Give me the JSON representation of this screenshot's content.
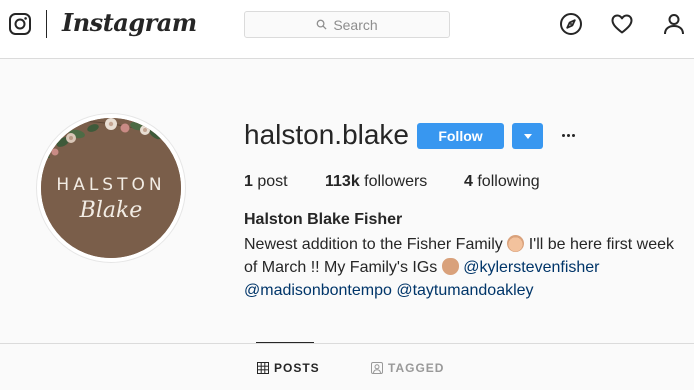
{
  "header": {
    "logo_text": "Instagram",
    "search_placeholder": "Search",
    "icons": [
      "instagram-glyph-icon",
      "search-icon",
      "explore-compass-icon",
      "heart-icon",
      "profile-icon"
    ]
  },
  "profile": {
    "avatar_text_line1": "HALSTON",
    "avatar_text_line2": "Blake",
    "username": "halston.blake",
    "follow_label": "Follow",
    "stats": {
      "posts_count": "1",
      "posts_label": "post",
      "followers_count": "113k",
      "followers_label": "followers",
      "following_count": "4",
      "following_label": "following"
    },
    "full_name": "Halston Blake Fisher",
    "bio": {
      "text1": "Newest addition to the Fisher Family",
      "text2": "I'll be here first week of March !! My Family's IGs",
      "mention1": "@kylerstevenfisher",
      "mention2": "@madisonbontempo",
      "mention3": "@taytumandoakley"
    }
  },
  "tabs": [
    {
      "label": "POSTS",
      "active": true
    },
    {
      "label": "TAGGED",
      "active": false
    }
  ],
  "colors": {
    "accent": "#3897f0",
    "mention": "#003569",
    "text": "#262626",
    "muted": "#999999"
  }
}
